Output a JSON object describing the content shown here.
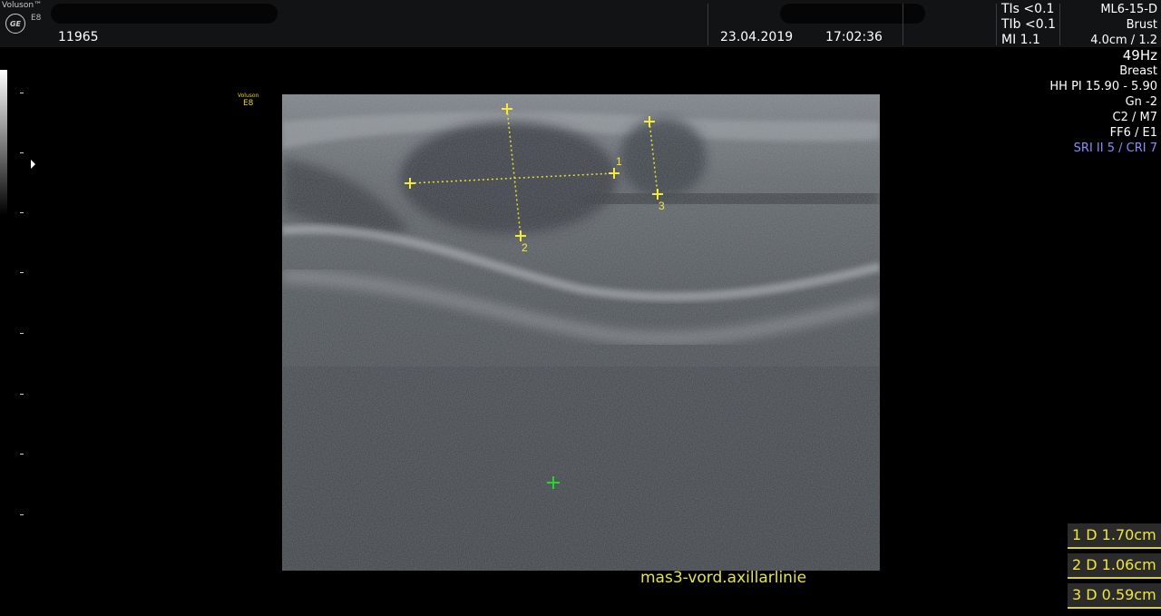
{
  "header": {
    "brand": "Voluson™",
    "model_small": "E8",
    "patient_id": "11965",
    "date": "23.04.2019",
    "time": "17:02:36"
  },
  "safety": {
    "tis": "TIs <0.1",
    "tib": "TIb <0.1",
    "mi": "MI  1.1"
  },
  "info": {
    "probe": "ML6-15-D",
    "application": "Brust",
    "depth_zoom": "4.0cm / 1.2",
    "frame_rate": "49Hz",
    "preset": "Breast",
    "harmonics": "HH PI 15.90 - 5.90",
    "gain": "Gn  -2",
    "c_m": "C2 / M7",
    "ff_e": "FF6 / E1",
    "sri_cri": "SRI II 5 / CRI 7"
  },
  "image": {
    "mini_brand_top": "Voluson",
    "mini_brand_bottom": "E8",
    "caliper_labels": [
      "1",
      "2",
      "3"
    ],
    "annotation": "mas3-vord.axillarlinie"
  },
  "measurements": [
    {
      "label": "1 D 1.70cm"
    },
    {
      "label": "2 D 1.06cm"
    },
    {
      "label": "3 D 0.59cm"
    }
  ],
  "colors": {
    "caliper": "#f5ea3a",
    "focus_marker": "#22d822",
    "sri_text": "#8c8cff",
    "annotation": "#e6e44a"
  }
}
